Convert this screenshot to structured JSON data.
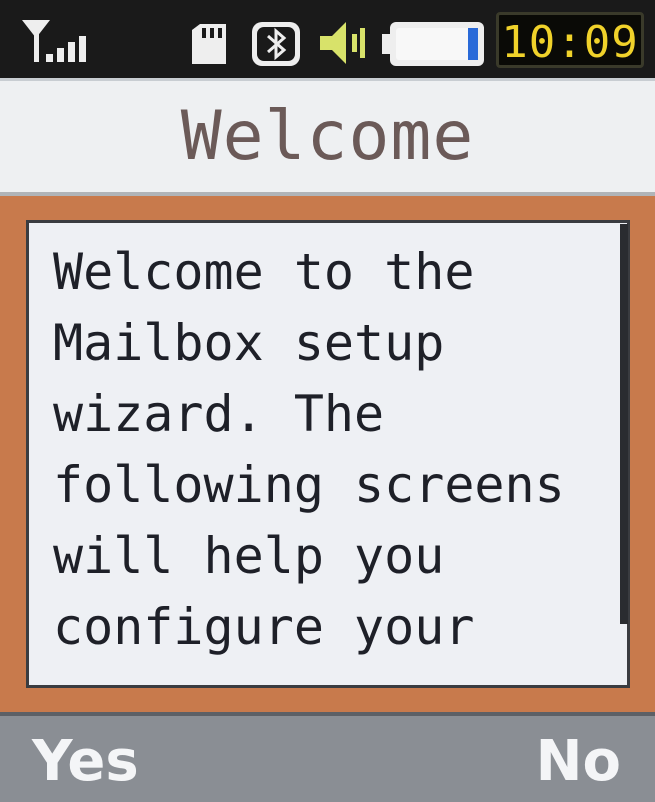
{
  "status_bar": {
    "time": "10:09",
    "icons": [
      "signal-icon",
      "memory-card-icon",
      "bluetooth-icon",
      "volume-icon",
      "battery-icon"
    ],
    "battery_level": 0.85
  },
  "header": {
    "title": "Welcome"
  },
  "content": {
    "lines": [
      "Welcome to the",
      "Mailbox setup",
      "wizard. The",
      "following screens",
      "will help you",
      "configure your"
    ]
  },
  "softkeys": {
    "left": "Yes",
    "right": "No"
  },
  "colors": {
    "frame": "#c87a4c",
    "clock": "#f0d22a",
    "softkey_bar": "#8a8e94"
  }
}
